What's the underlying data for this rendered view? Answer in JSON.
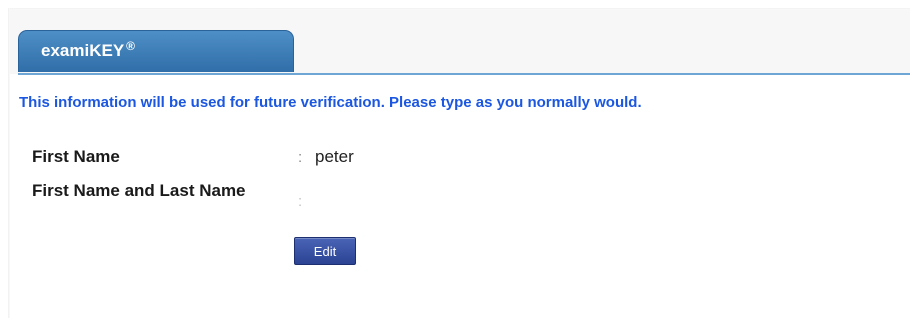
{
  "header": {
    "tab_title": "examiKEY",
    "tab_registered_mark": "®"
  },
  "notice": "This information will be used for future verification. Please type as you normally would.",
  "fields": [
    {
      "label": "First Name",
      "separator": ":",
      "value": "peter"
    },
    {
      "label": "First Name and Last Name",
      "separator": ":",
      "value": ""
    }
  ],
  "actions": {
    "edit_label": "Edit"
  },
  "colors": {
    "tab": "#3a7bb8",
    "notice_text": "#1b57e0",
    "button": "#2f4a9c"
  }
}
